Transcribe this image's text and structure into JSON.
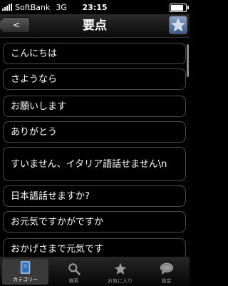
{
  "status": {
    "carrier": "SoftBank",
    "network": "3G",
    "time": "23:15",
    "battery_level": 0.85
  },
  "nav": {
    "back_label": "<",
    "title": "要点",
    "star_icon": "star-icon"
  },
  "list": {
    "items": [
      "こんにちは",
      "さようなら",
      "お願いします",
      "ありがとう",
      "すいません、イタリア語話せません\\n",
      "日本語話せますか?",
      "お元気ですかがですか",
      "おかげさまで元気です"
    ]
  },
  "tabs": [
    {
      "label": "カテゴリー",
      "icon": "book-icon",
      "active": true
    },
    {
      "label": "検索",
      "icon": "search-icon",
      "active": false
    },
    {
      "label": "お気に入り",
      "icon": "star-icon",
      "active": false
    },
    {
      "label": "設定",
      "icon": "speech-bubble-icon",
      "active": false
    }
  ],
  "colors": {
    "background": "#000000",
    "border": "#4a4a4a",
    "tab_active": "#3a3a3a"
  }
}
